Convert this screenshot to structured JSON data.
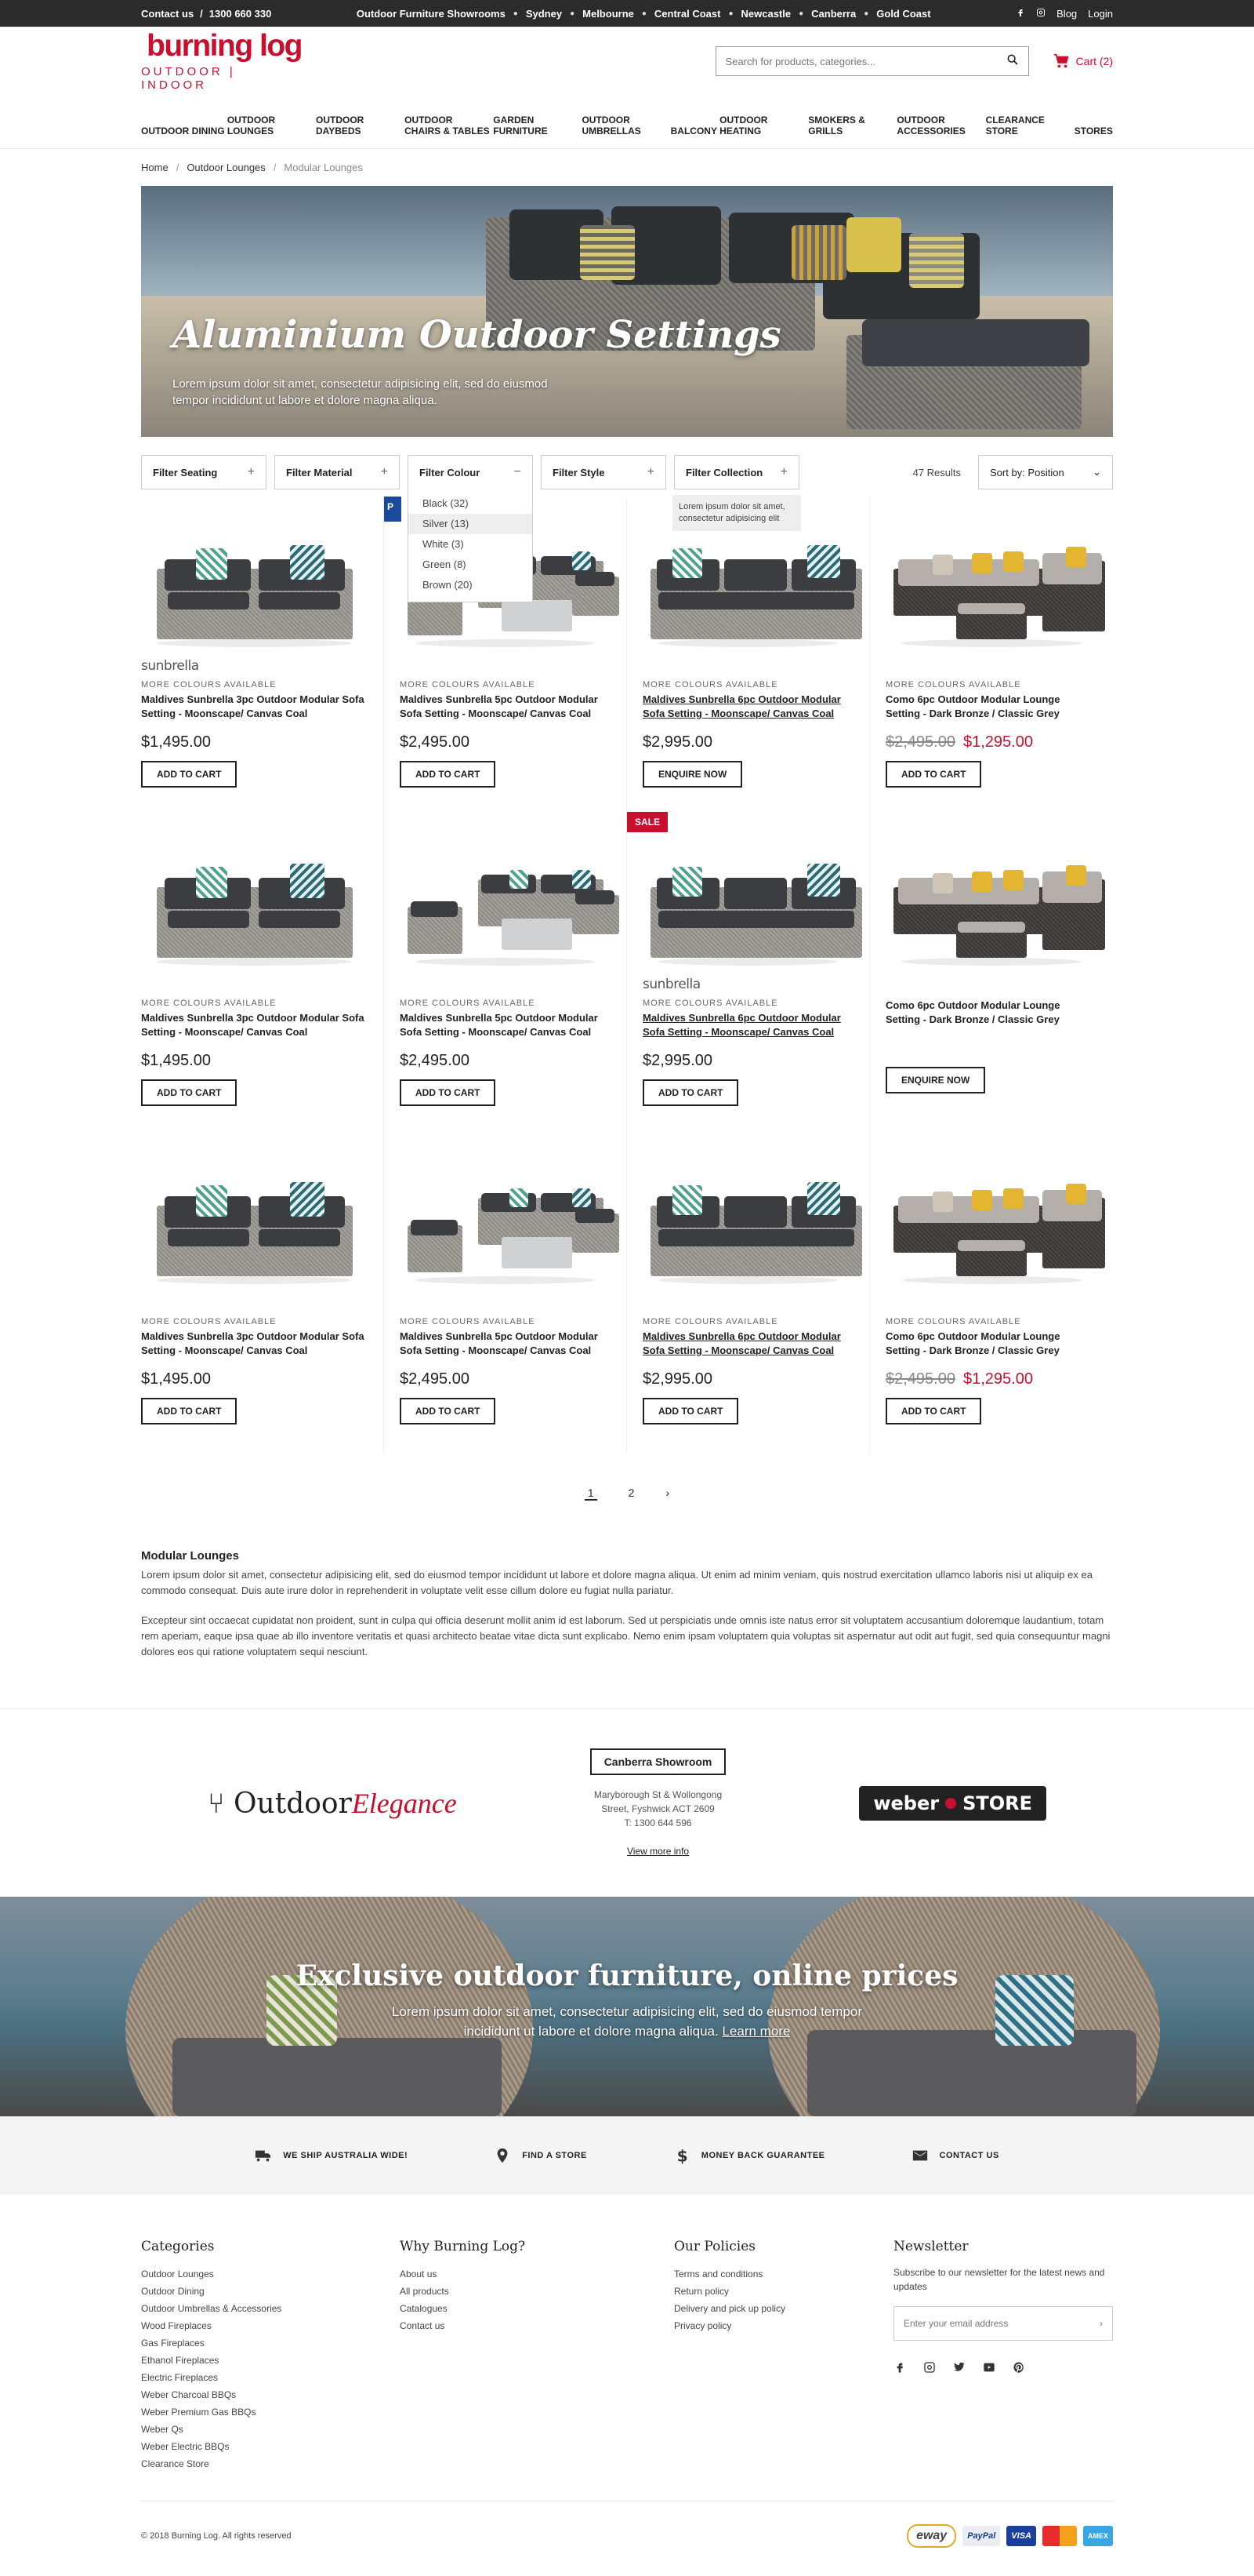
{
  "topbar": {
    "contact": "Contact us",
    "phone": "1300 660 330",
    "showrooms_label": "Outdoor Furniture Showrooms",
    "locations": [
      "Sydney",
      "Melbourne",
      "Central Coast",
      "Newcastle",
      "Canberra",
      "Gold Coast"
    ],
    "blog": "Blog",
    "login": "Login"
  },
  "header": {
    "logo_main": "burning log",
    "logo_sub": "OUTDOOR | INDOOR",
    "search_placeholder": "Search for products, categories...",
    "cart": "Cart (2)"
  },
  "nav": [
    "OUTDOOR DINING",
    "OUTDOOR LOUNGES",
    "OUTDOOR DAYBEDS",
    "OUTDOOR CHAIRS & TABLES",
    "GARDEN FURNITURE",
    "OUTDOOR UMBRELLAS",
    "BALCONY",
    "OUTDOOR HEATING",
    "SMOKERS & GRILLS",
    "OUTDOOR ACCESSORIES",
    "CLEARANCE STORE",
    "STORES"
  ],
  "breadcrumb": {
    "home": "Home",
    "level1": "Outdoor Lounges",
    "current": "Modular Lounges"
  },
  "hero": {
    "title": "Aluminium Outdoor Settings",
    "text": "Lorem ipsum dolor sit amet, consectetur adipisicing elit, sed do eiusmod tempor incididunt ut labore et dolore magna aliqua."
  },
  "filters": {
    "seating": "Filter Seating",
    "material": "Filter Material",
    "colour": "Filter Colour",
    "style": "Filter Style",
    "collection": "Filter Collection",
    "results": "47 Results",
    "sort_label": "Sort by:",
    "sort_value": "Position",
    "colour_options": [
      "Black (32)",
      "Silver (13)",
      "White (3)",
      "Green (8)",
      "Brown (20)"
    ],
    "tooltip": "Lorem ipsum dolor sit amet, consectetur adipisicing elit"
  },
  "products": [
    {
      "brand": "sunbrella",
      "more": "MORE COLOURS AVAILABLE",
      "title": "Maldives Sunbrella 3pc Outdoor Modular Sofa Setting - Moonscape/ Canvas Coal",
      "price": "$1,495.00",
      "old": "",
      "btn": "ADD TO CART",
      "img": "3pc"
    },
    {
      "brand": "",
      "more": "MORE COLOURS AVAILABLE",
      "title": "Maldives Sunbrella 5pc Outdoor Modular Sofa Setting - Moonscape/ Canvas Coal",
      "price": "$2,495.00",
      "old": "",
      "btn": "ADD TO CART",
      "img": "5pc",
      "badge": "P"
    },
    {
      "brand": "",
      "more": "MORE COLOURS AVAILABLE",
      "title": "Maldives Sunbrella 6pc Outdoor Modular Sofa Setting - Moonscape/ Canvas Coal",
      "price": "$2,995.00",
      "old": "",
      "btn": "ENQUIRE NOW",
      "img": "6pc",
      "u": true
    },
    {
      "brand": "",
      "more": "MORE COLOURS AVAILABLE",
      "title": "Como 6pc Outdoor Modular Lounge Setting - Dark Bronze / Classic Grey",
      "price": "$1,295.00",
      "old": "$2,495.00",
      "btn": "ADD TO CART",
      "img": "como"
    },
    {
      "brand": "",
      "more": "MORE COLOURS AVAILABLE",
      "title": "Maldives Sunbrella 3pc Outdoor Modular Sofa Setting - Moonscape/ Canvas Coal",
      "price": "$1,495.00",
      "old": "",
      "btn": "ADD TO CART",
      "img": "3pc"
    },
    {
      "brand": "",
      "more": "MORE COLOURS AVAILABLE",
      "title": "Maldives Sunbrella 5pc Outdoor Modular Sofa Setting - Moonscape/ Canvas Coal",
      "price": "$2,495.00",
      "old": "",
      "btn": "ADD TO CART",
      "img": "5pc"
    },
    {
      "brand": "sunbrella",
      "more": "MORE COLOURS AVAILABLE",
      "title": "Maldives Sunbrella 6pc Outdoor Modular Sofa Setting - Moonscape/ Canvas Coal",
      "price": "$2,995.00",
      "old": "",
      "btn": "ADD TO CART",
      "img": "6pc",
      "u": true,
      "badge": "SALE"
    },
    {
      "brand": "",
      "more": "",
      "title": "Como 6pc Outdoor Modular Lounge Setting - Dark Bronze / Classic Grey",
      "price": "",
      "old": "",
      "btn": "ENQUIRE NOW",
      "img": "como"
    },
    {
      "brand": "",
      "more": "MORE COLOURS AVAILABLE",
      "title": "Maldives Sunbrella 3pc Outdoor Modular Sofa Setting - Moonscape/ Canvas Coal",
      "price": "$1,495.00",
      "old": "",
      "btn": "ADD TO CART",
      "img": "3pc"
    },
    {
      "brand": "",
      "more": "MORE COLOURS AVAILABLE",
      "title": "Maldives Sunbrella 5pc Outdoor Modular Sofa Setting - Moonscape/ Canvas Coal",
      "price": "$2,495.00",
      "old": "",
      "btn": "ADD TO CART",
      "img": "5pc"
    },
    {
      "brand": "",
      "more": "MORE COLOURS AVAILABLE",
      "title": "Maldives Sunbrella 6pc Outdoor Modular Sofa Setting - Moonscape/ Canvas Coal",
      "price": "$2,995.00",
      "old": "",
      "btn": "ADD TO CART",
      "img": "6pc",
      "u": true
    },
    {
      "brand": "",
      "more": "MORE COLOURS AVAILABLE",
      "title": "Como 6pc Outdoor Modular Lounge Setting - Dark Bronze / Classic Grey",
      "price": "$1,295.00",
      "old": "$2,495.00",
      "btn": "ADD TO CART",
      "img": "como"
    }
  ],
  "pager": {
    "p1": "1",
    "p2": "2",
    "next": "›"
  },
  "description": {
    "title": "Modular Lounges",
    "p1": "Lorem ipsum dolor sit amet, consectetur adipisicing elit, sed do eiusmod tempor incididunt ut labore et dolore magna aliqua. Ut enim ad minim veniam, quis nostrud exercitation ullamco laboris nisi ut aliquip ex ea commodo consequat. Duis aute irure dolor in reprehenderit in voluptate velit esse cillum dolore eu fugiat nulla pariatur.",
    "p2": "Excepteur sint occaecat cupidatat non proident, sunt in culpa qui officia deserunt mollit anim id est laborum. Sed ut perspiciatis unde omnis iste natus error sit voluptatem accusantium doloremque laudantium, totam rem aperiam, eaque ipsa quae ab illo inventore veritatis et quasi architecto beatae vitae dicta sunt explicabo. Nemo enim ipsam voluptatem quia voluptas sit aspernatur aut odit aut fugit, sed quia consequuntur magni dolores eos qui ratione voluptatem sequi nesciunt."
  },
  "showroom": {
    "oe_outdoor": "Outdoor",
    "oe_elegance": "Elegance",
    "title": "Canberra Showroom",
    "addr1": "Maryborough St & Wollongong",
    "addr2": "Street, Fyshwick ACT 2609",
    "phone": "T: 1300 644 596",
    "more": "View more info",
    "weber": "weber",
    "store": "STORE"
  },
  "banner": {
    "title": "Exclusive outdoor furniture, online prices",
    "text": "Lorem ipsum dolor sit amet, consectetur adipisicing elit, sed do eiusmod tempor incididunt ut labore et dolore magna aliqua.",
    "link": "Learn more"
  },
  "usp": [
    "WE SHIP AUSTRALIA WIDE!",
    "FIND A STORE",
    "MONEY BACK GUARANTEE",
    "CONTACT US"
  ],
  "footer": {
    "categories_title": "Categories",
    "categories": [
      "Outdoor Lounges",
      "Outdoor Dining",
      "Outdoor Umbrellas & Accessories",
      "Wood Fireplaces",
      "Gas Fireplaces",
      "Ethanol Fireplaces",
      "Electric Fireplaces",
      "Weber Charcoal BBQs",
      "Weber Premium Gas BBQs",
      "Weber Qs",
      "Weber Electric BBQs",
      "Clearance Store"
    ],
    "why_title": "Why Burning Log?",
    "why": [
      "About us",
      "All products",
      "Catalogues",
      "Contact us"
    ],
    "policies_title": "Our Policies",
    "policies": [
      "Terms and conditions",
      "Return policy",
      "Delivery and pick up policy",
      "Privacy policy"
    ],
    "newsletter_title": "Newsletter",
    "newsletter_text": "Subscribe to our newsletter for the latest news and updates",
    "email_placeholder": "Enter your email address",
    "copyright": "© 2018 Burning Log. All rights reserved",
    "payments": [
      "eway",
      "PayPal",
      "VISA",
      "MC",
      "AMEX"
    ]
  }
}
